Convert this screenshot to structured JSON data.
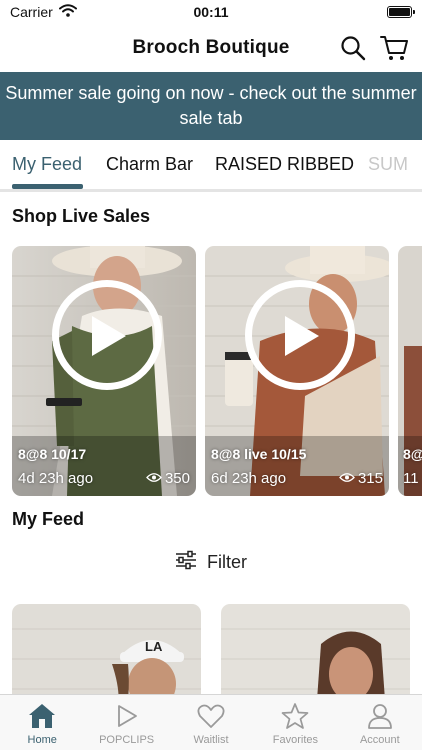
{
  "status_bar": {
    "carrier": "Carrier",
    "time": "00:11"
  },
  "header": {
    "title": "Brooch Boutique"
  },
  "banner": {
    "text": "Summer sale going on now - check out the summer sale tab"
  },
  "tabs": [
    {
      "label": "My Feed",
      "active": true
    },
    {
      "label": "Charm Bar",
      "active": false
    },
    {
      "label": "RAISED RIBBED",
      "active": false
    },
    {
      "label": "SUM",
      "active": false
    }
  ],
  "live_section": {
    "title": "Shop Live Sales",
    "cards": [
      {
        "title": "8@8 10/17",
        "ago": "4d 23h ago",
        "views": "350"
      },
      {
        "title": "8@8 live 10/15",
        "ago": "6d 23h ago",
        "views": "315"
      },
      {
        "title": "8@",
        "ago": "11"
      }
    ]
  },
  "feed_section": {
    "title": "My Feed",
    "filter_label": "Filter"
  },
  "bottom_nav": [
    {
      "label": "Home",
      "icon": "home-icon",
      "active": true
    },
    {
      "label": "POPCLIPS",
      "icon": "play-icon",
      "active": false
    },
    {
      "label": "Waitlist",
      "icon": "heart-icon",
      "active": false
    },
    {
      "label": "Favorites",
      "icon": "star-icon",
      "active": false
    },
    {
      "label": "Account",
      "icon": "person-icon",
      "active": false
    }
  ],
  "colors": {
    "accent": "#3b6170",
    "inactive": "#9a9a9a",
    "tab_border": "#e4e4e4"
  }
}
